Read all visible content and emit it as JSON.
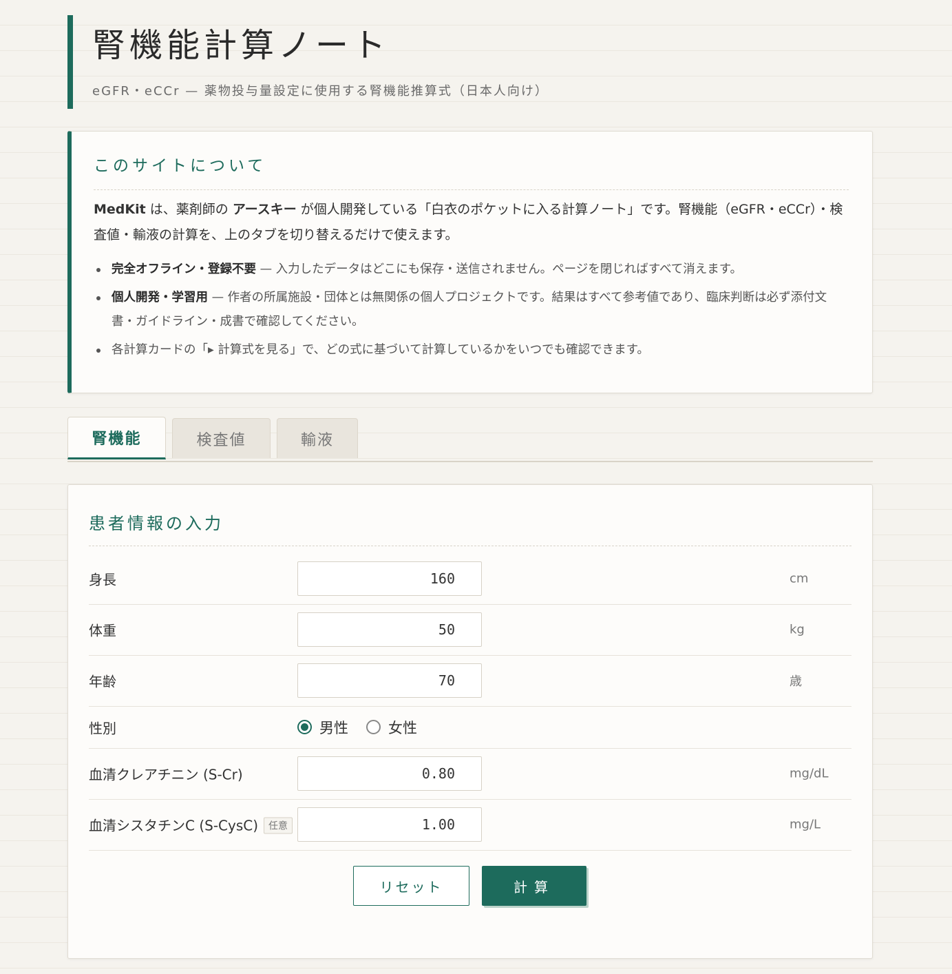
{
  "header": {
    "title": "腎機能計算ノート",
    "subtitle": "eGFR・eCCr — 薬物投与量設定に使用する腎機能推算式（日本人向け）"
  },
  "about": {
    "title": "このサイトについて",
    "body": {
      "brand": "MedKit",
      "t1": " は、薬剤師の ",
      "author": "アースキー",
      "t2": " が個人開発している「白衣のポケットに入る計算ノート」です。腎機能（eGFR・eCCr）・検査値・輸液の計算を、上のタブを切り替えるだけで使えます。"
    },
    "bullets": [
      {
        "bold": "完全オフライン・登録不要",
        "text": " — 入力したデータはどこにも保存・送信されません。ページを閉じればすべて消えます。"
      },
      {
        "bold": "個人開発・学習用",
        "text": " — 作者の所属施設・団体とは無関係の個人プロジェクトです。結果はすべて参考値であり、臨床判断は必ず添付文書・ガイドライン・成書で確認してください。"
      },
      {
        "bold": "",
        "text": "各計算カードの「▸ 計算式を見る」で、どの式に基づいて計算しているかをいつでも確認できます。"
      }
    ]
  },
  "tabs": [
    {
      "label": "腎機能",
      "active": true
    },
    {
      "label": "検査値",
      "active": false
    },
    {
      "label": "輸液",
      "active": false
    }
  ],
  "form": {
    "title": "患者情報の入力",
    "height": {
      "label": "身長",
      "value": "160",
      "unit": "cm"
    },
    "weight": {
      "label": "体重",
      "value": "50",
      "unit": "kg"
    },
    "age": {
      "label": "年齢",
      "value": "70",
      "unit": "歳"
    },
    "sex": {
      "label": "性別",
      "male": "男性",
      "female": "女性",
      "selected": "male"
    },
    "scr": {
      "label": "血清クレアチニン (S-Cr)",
      "value": "0.80",
      "unit": "mg/dL"
    },
    "cysc": {
      "label": "血清シスタチンC (S-CysC)",
      "badge": "任意",
      "value": "1.00",
      "unit": "mg/L"
    },
    "reset_label": "リセット",
    "calc_label": "計算"
  },
  "colors": {
    "accent": "#1d6b5c",
    "background": "#f5f3ee",
    "card": "#fdfcfa"
  }
}
